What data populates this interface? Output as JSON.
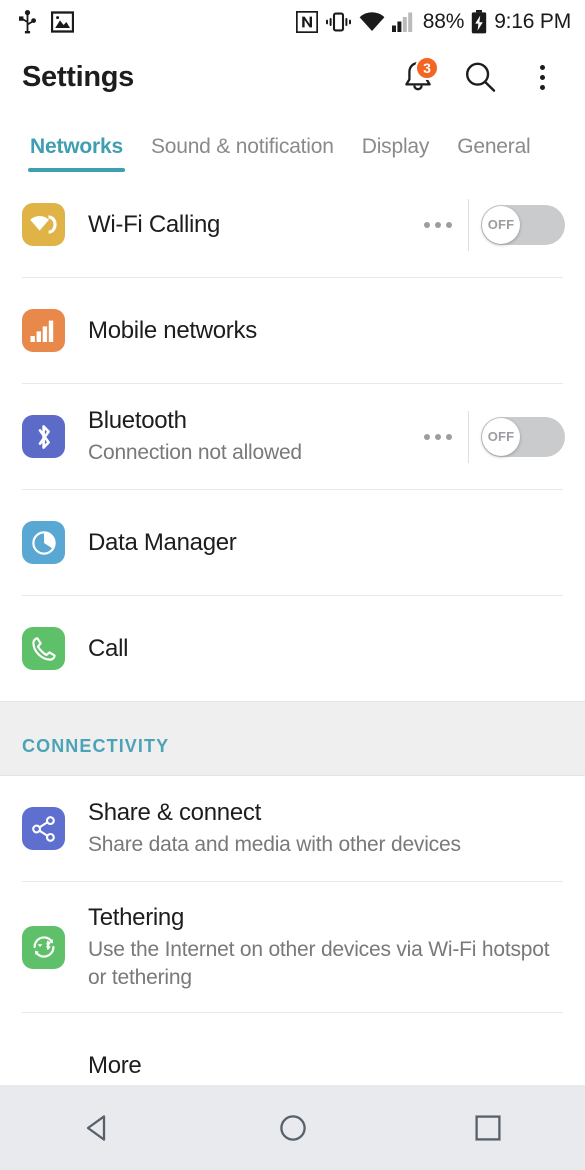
{
  "statusbar": {
    "left_icons": [
      {
        "name": "usb-icon",
        "label": "USB"
      },
      {
        "name": "photo-icon",
        "label": "Screenshot"
      }
    ],
    "right_icons": [
      {
        "name": "nfc-icon",
        "label": "NFC"
      },
      {
        "name": "vibrate-icon",
        "label": "Vibrate"
      },
      {
        "name": "wifi-icon",
        "label": "Wi-Fi"
      },
      {
        "name": "signal-icon",
        "label": "Signal"
      }
    ],
    "battery_percent": "88%",
    "battery_state": "charging",
    "clock": "9:16 PM"
  },
  "header": {
    "title": "Settings",
    "notifications_badge": "3",
    "icons": [
      "bell-icon",
      "search-icon",
      "overflow-menu-icon"
    ]
  },
  "tabs": {
    "active_index": 0,
    "items": [
      {
        "label": "Networks"
      },
      {
        "label": "Sound & notification"
      },
      {
        "label": "Display"
      },
      {
        "label": "General"
      }
    ]
  },
  "colors": {
    "accent": "#3f9fb0",
    "section_label": "#4ba3b8",
    "badge": "#f26522",
    "wifi_calling_icon": "#e0b347",
    "mobile_networks_icon": "#e8884a",
    "bluetooth_icon": "#5c6bc8",
    "data_manager_icon": "#59a8d4",
    "call_icon": "#5fc06a",
    "share_connect_icon": "#5f6fd0",
    "tethering_icon": "#5fc06a",
    "toggle_track": "#c9cbcd"
  },
  "list": {
    "rows": [
      {
        "id": "wifi-calling",
        "title": "Wi-Fi Calling",
        "subtitle": "",
        "icon": "wifi-calling-icon",
        "has_menu": true,
        "toggle": {
          "state": "OFF",
          "label": "OFF"
        }
      },
      {
        "id": "mobile-networks",
        "title": "Mobile networks",
        "subtitle": "",
        "icon": "mobile-networks-icon",
        "has_menu": false,
        "toggle": null
      },
      {
        "id": "bluetooth",
        "title": "Bluetooth",
        "subtitle": "Connection not allowed",
        "icon": "bluetooth-icon",
        "has_menu": true,
        "toggle": {
          "state": "OFF",
          "label": "OFF"
        }
      },
      {
        "id": "data-manager",
        "title": "Data Manager",
        "subtitle": "",
        "icon": "data-manager-icon",
        "has_menu": false,
        "toggle": null
      },
      {
        "id": "call",
        "title": "Call",
        "subtitle": "",
        "icon": "call-icon",
        "has_menu": false,
        "toggle": null
      }
    ]
  },
  "connectivity": {
    "section_label": "CONNECTIVITY",
    "rows": [
      {
        "id": "share-connect",
        "title": "Share & connect",
        "subtitle": "Share data and media with other devices",
        "icon": "share-connect-icon"
      },
      {
        "id": "tethering",
        "title": "Tethering",
        "subtitle": "Use the Internet on other devices via Wi-Fi hotspot or tethering",
        "icon": "tethering-icon"
      },
      {
        "id": "more",
        "title": "More",
        "subtitle": "",
        "icon": ""
      }
    ]
  },
  "navbar": {
    "buttons": [
      {
        "name": "back-button",
        "label": "Back"
      },
      {
        "name": "home-button",
        "label": "Home"
      },
      {
        "name": "recents-button",
        "label": "Recent apps"
      }
    ]
  }
}
